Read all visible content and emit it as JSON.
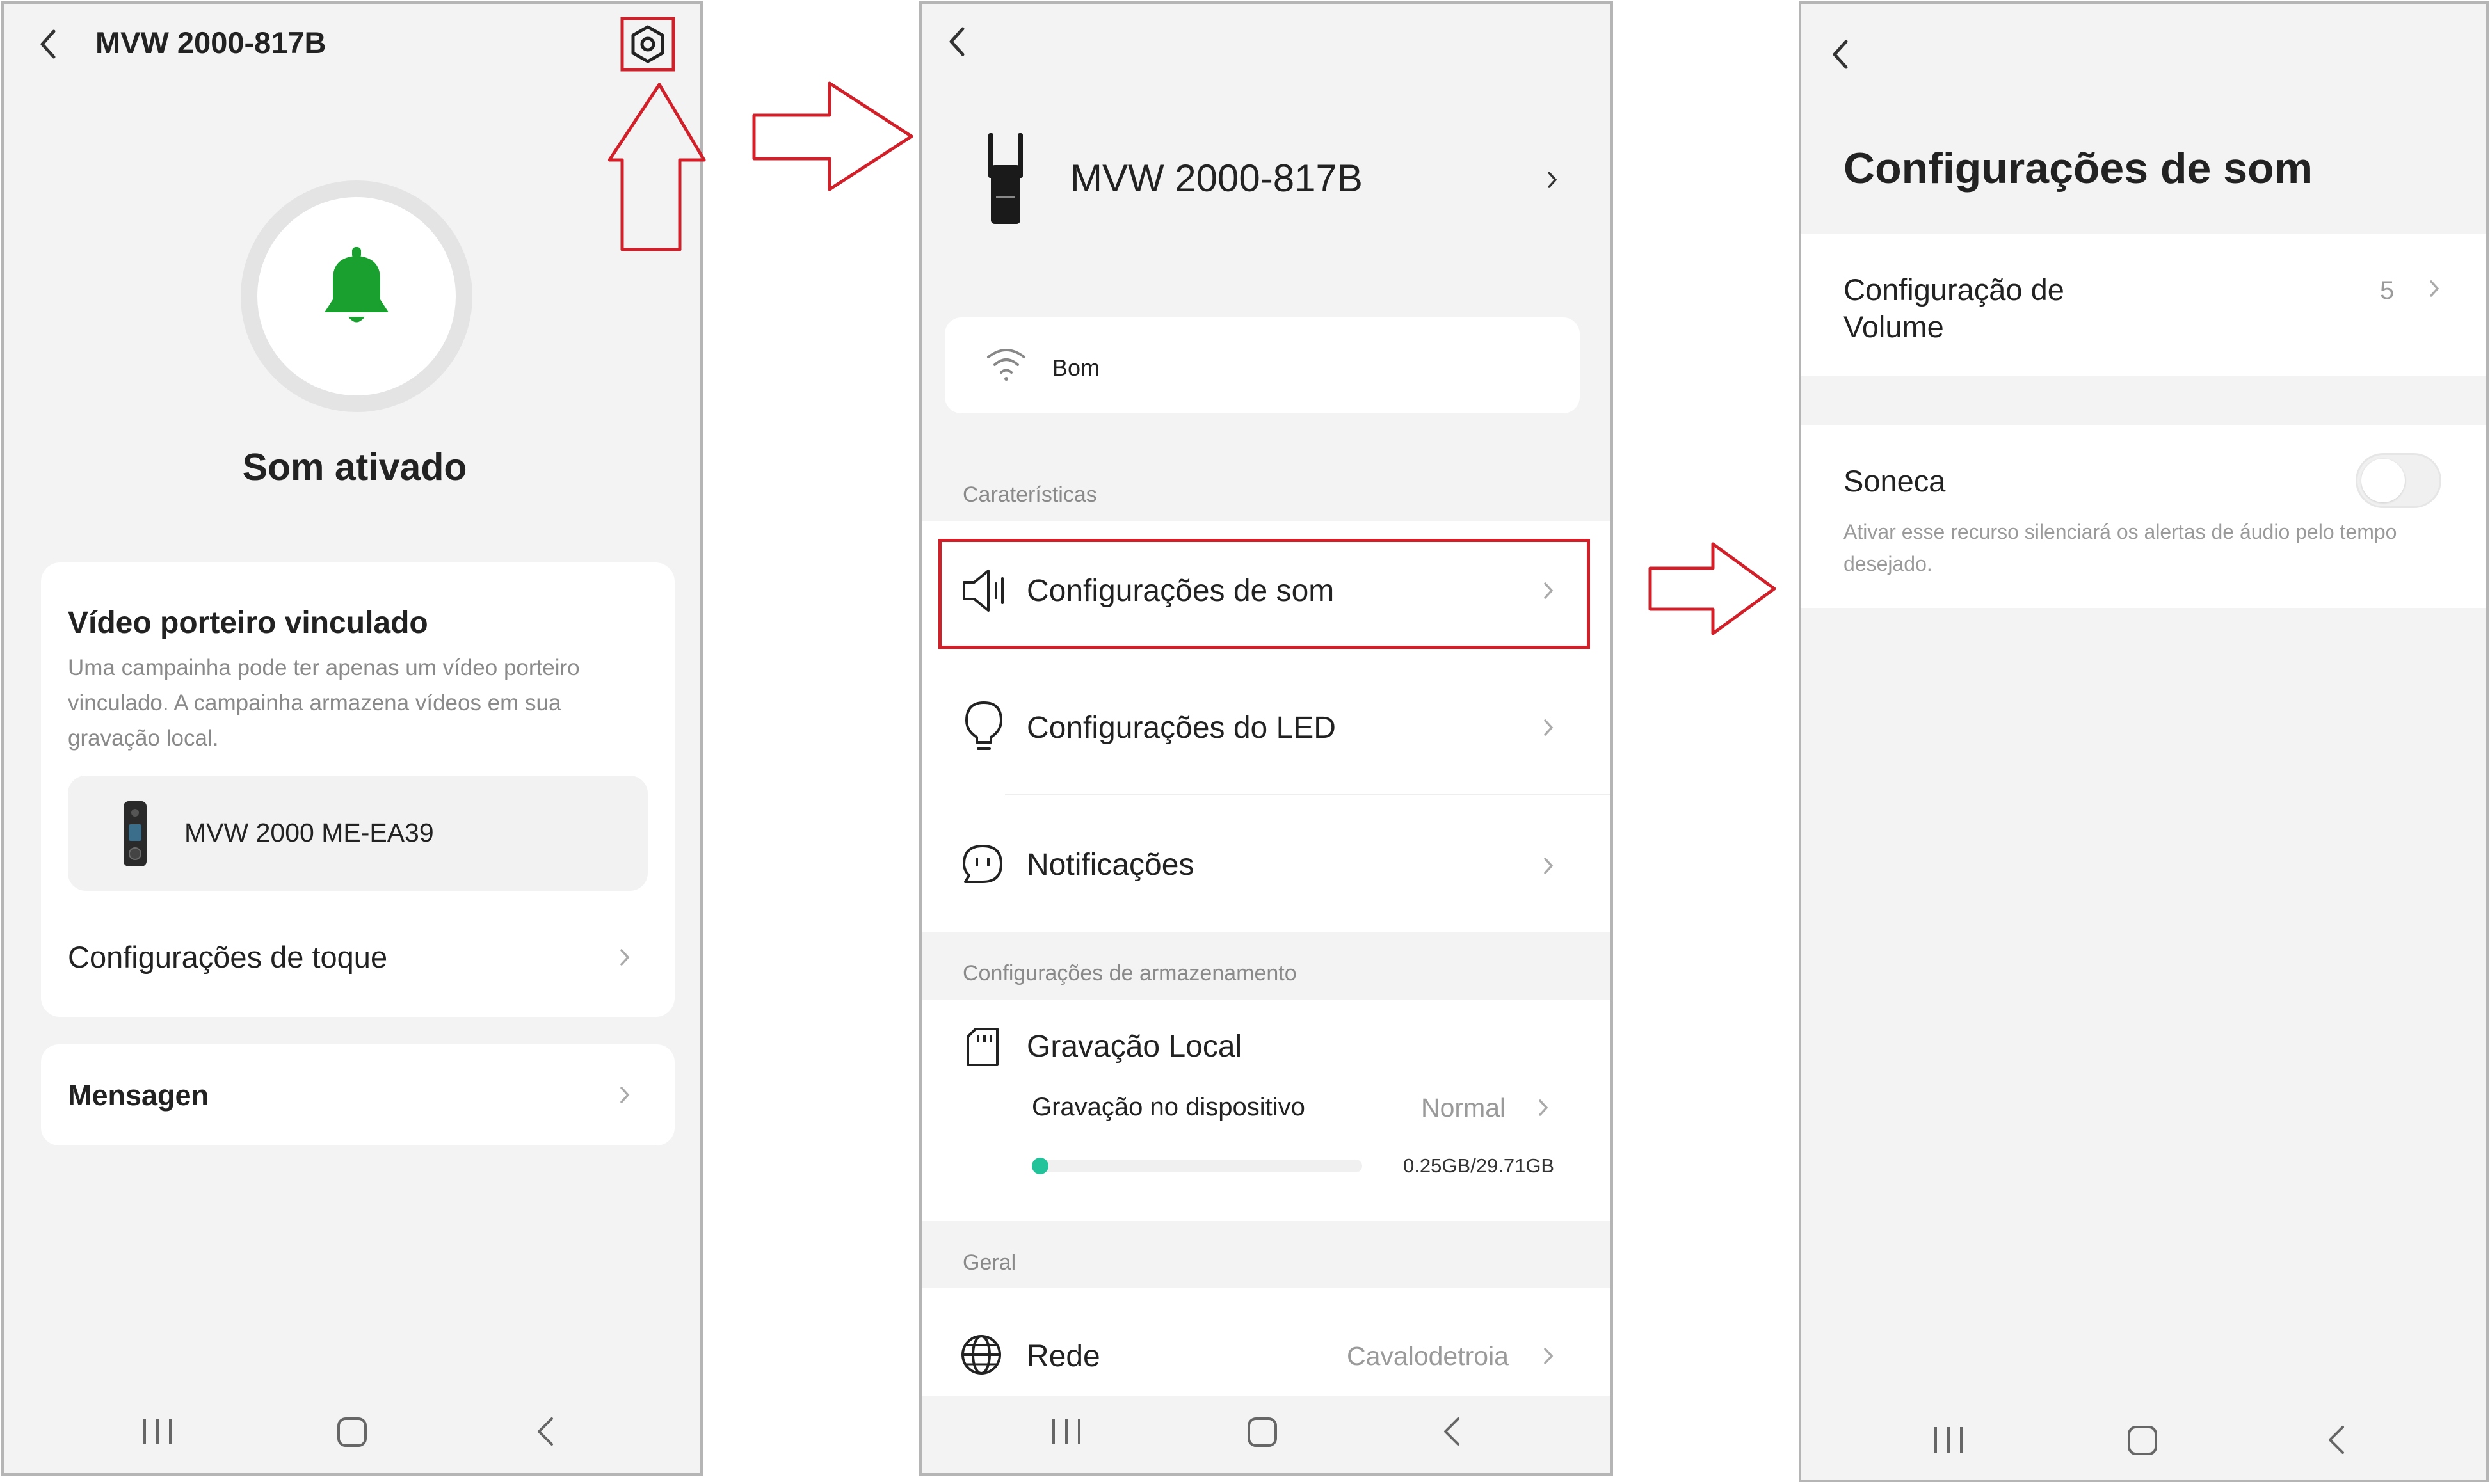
{
  "screen1": {
    "title": "MVW 2000-817B",
    "status": "Som ativado",
    "linked_heading": "Vídeo porteiro vinculado",
    "linked_description": "Uma campainha pode ter apenas um vídeo porteiro vinculado. A campainha armazena vídeos em sua gravação local.",
    "linked_device": "MVW 2000 ME-EA39",
    "ring_settings": "Configurações de toque",
    "messages": "Mensagen",
    "icons": [
      "back-icon",
      "settings-gear-icon",
      "bell-icon",
      "chevron-right-icon"
    ]
  },
  "screen2": {
    "device_name": "MVW 2000-817B",
    "wifi_status": "Bom",
    "section_features": "Caraterísticas",
    "sound_settings": "Configurações de som",
    "led_settings": "Configurações do LED",
    "notifications": "Notificações",
    "section_storage": "Configurações de armazenamento",
    "local_recording": "Gravação Local",
    "device_recording": "Gravação no dispositivo",
    "device_recording_value": "Normal",
    "storage_usage": "0.25GB/29.71GB",
    "storage_used_fraction": 0.0084,
    "section_general": "Geral",
    "network": "Rede",
    "network_value": "Cavalodetroia",
    "icons": [
      "back-icon",
      "device-icon",
      "wifi-icon",
      "speaker-icon",
      "bulb-icon",
      "chat-icon",
      "sdcard-icon",
      "globe-icon"
    ]
  },
  "screen3": {
    "title": "Configurações de som",
    "volume_label": "Configuração de Volume",
    "volume_value": "5",
    "snooze_label": "Soneca",
    "snooze_enabled": false,
    "snooze_description": "Ativar esse recurso silenciará os alertas de áudio pelo tempo desejado."
  },
  "colors": {
    "highlight_red": "#d0202a",
    "bell_green": "#1aa02e",
    "storage_teal": "#22c29a"
  }
}
